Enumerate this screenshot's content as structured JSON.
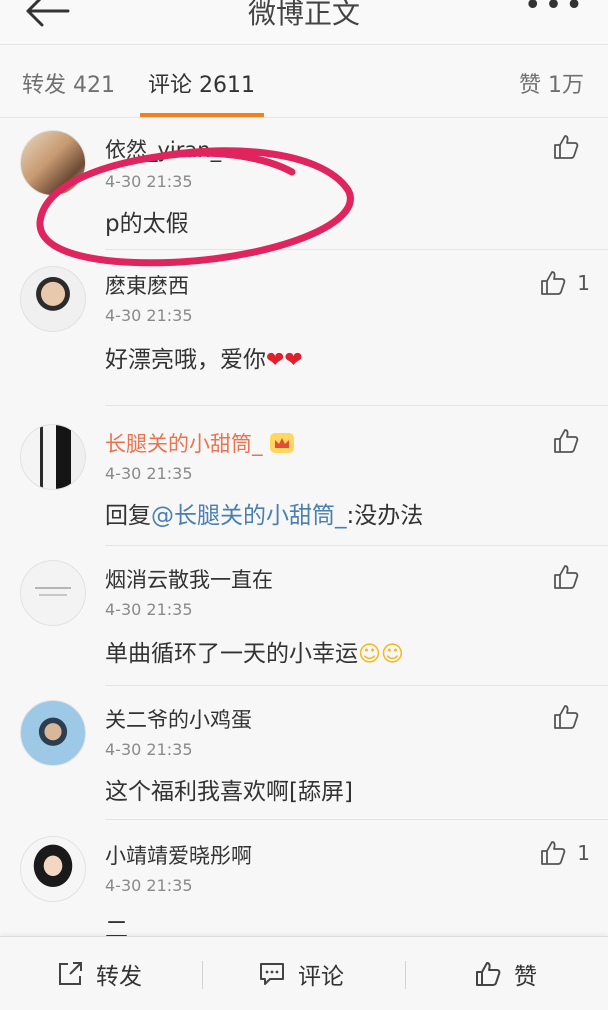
{
  "navbar": {
    "title": "微博正文",
    "back_icon": "arrow-left-icon",
    "more_icon": "more-dots-icon"
  },
  "tabs": {
    "repost": "转发 421",
    "comments": "评论 2611",
    "likes": "赞 1万",
    "accent": "#f2811d"
  },
  "comments": [
    {
      "user": "依然_yiran_",
      "time": "4-30 21:35",
      "text": "p的太假",
      "likes": ""
    },
    {
      "user": "麽東麽西",
      "time": "4-30 21:35",
      "text": "好漂亮哦，爱你",
      "emoji": "❤❤",
      "likes": "1"
    },
    {
      "user": "长腿关的小甜筒_",
      "time": "4-30 21:35",
      "text_prefix": "回复",
      "mention": "@长腿关的小甜筒_",
      "text_suffix": ":没办法",
      "likes": ""
    },
    {
      "user": "烟消云散我一直在",
      "time": "4-30 21:35",
      "text": "单曲循环了一天的小幸运",
      "emoji": "☺☺",
      "likes": ""
    },
    {
      "user": "关二爷的小鸡蛋",
      "time": "4-30 21:35",
      "text": "这个福利我喜欢啊[舔屏]",
      "likes": ""
    },
    {
      "user": "小靖靖爱晓彤啊",
      "time": "4-30 21:35",
      "text": "二",
      "likes": "1"
    }
  ],
  "toolbar": {
    "repost": "转发",
    "comment": "评论",
    "like": "赞"
  },
  "colors": {
    "vip_name": "#eb7350",
    "mention": "#4a7fb1",
    "annotation": "#e0245e"
  }
}
